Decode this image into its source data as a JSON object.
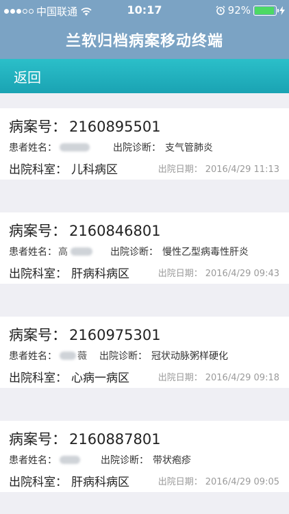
{
  "status": {
    "carrier": "中国联通",
    "time": "10:17",
    "battery": "92%",
    "battery_level": 0.92,
    "icons": [
      "signal-dots-icon",
      "wifi-icon",
      "alarm-icon",
      "battery-icon",
      "charging-icon"
    ]
  },
  "header": {
    "title": "兰软归档病案移动终端"
  },
  "nav": {
    "back_label": "返回"
  },
  "labels": {
    "case_no": "病案号：",
    "patient": "患者姓名：",
    "diagnosis": "出院诊断：",
    "department": "出院科室：",
    "date": "出院日期："
  },
  "records": [
    {
      "case_no": "2160895501",
      "patient_visible": "",
      "diagnosis": "支气管肺炎",
      "department": "儿科病区",
      "date": "2016/4/29 11:13"
    },
    {
      "case_no": "2160846801",
      "patient_visible": "高",
      "diagnosis": "慢性乙型病毒性肝炎",
      "department": "肝病科病区",
      "date": "2016/4/29 09:43"
    },
    {
      "case_no": "2160975301",
      "patient_visible": "薇",
      "diagnosis": "冠状动脉粥样硬化",
      "department": "心病一病区",
      "date": "2016/4/29 09:18"
    },
    {
      "case_no": "2160887801",
      "patient_visible": "",
      "diagnosis": "带状疱疹",
      "department": "肝病科病区",
      "date": "2016/4/29 09:05"
    }
  ],
  "colors": {
    "header_bg": "#7ba3c4",
    "nav_bg": "#1aa3b3",
    "battery_fill": "#4cd964"
  }
}
